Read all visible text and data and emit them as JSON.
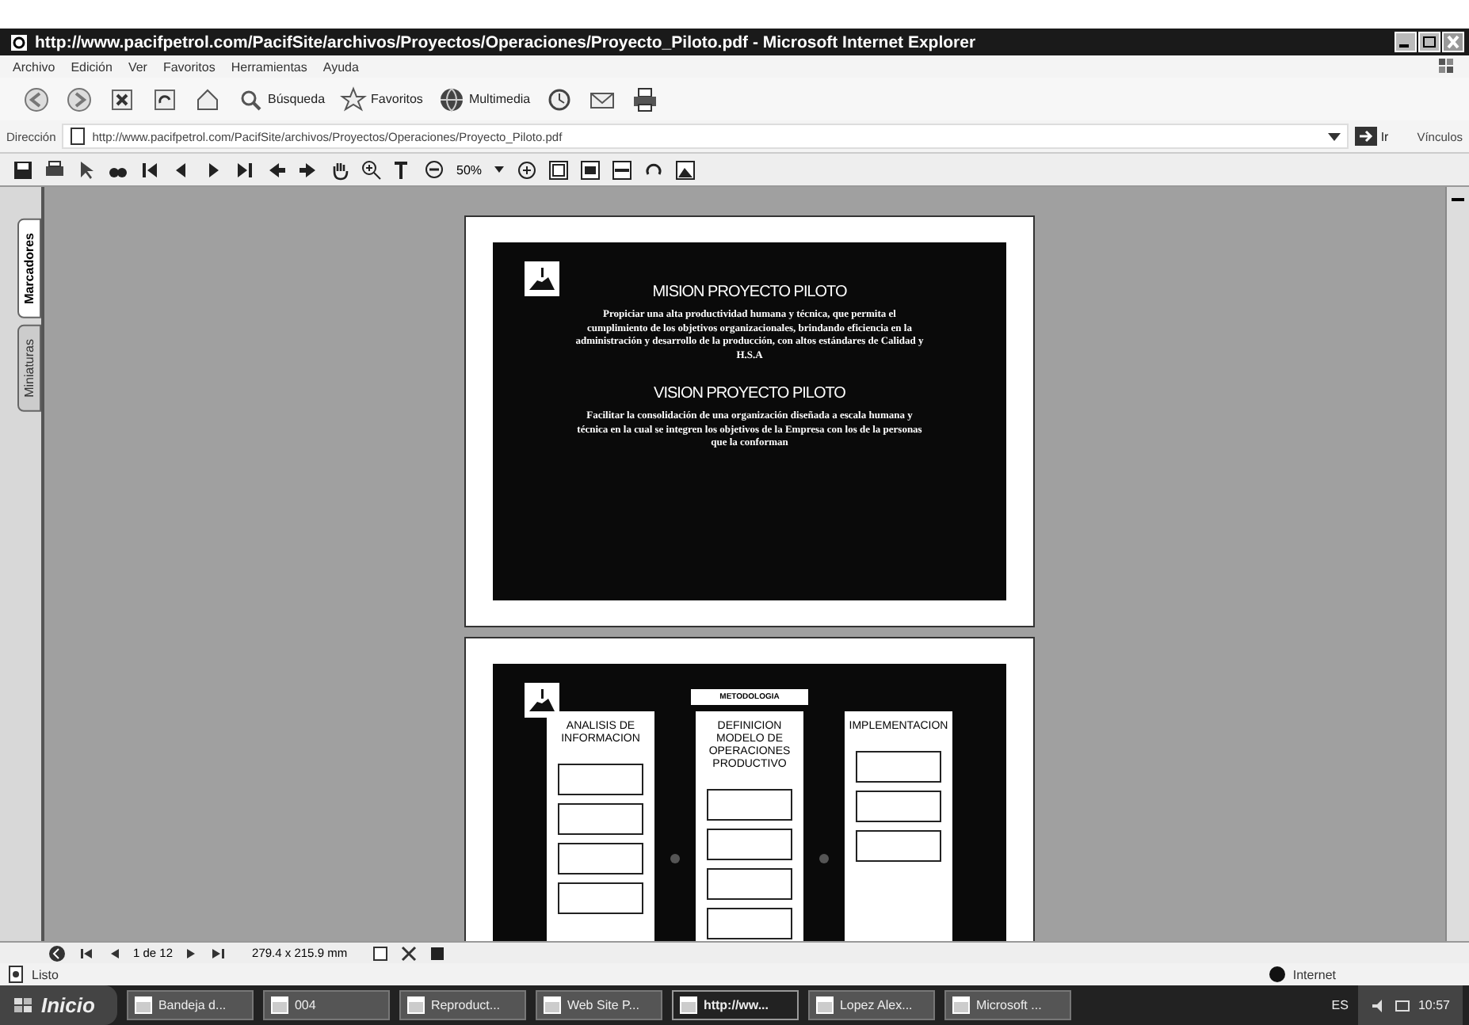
{
  "window": {
    "title": "http://www.pacifpetrol.com/PacifSite/archivos/Proyectos/Operaciones/Proyecto_Piloto.pdf - Microsoft Internet Explorer"
  },
  "menu": [
    "Archivo",
    "Edición",
    "Ver",
    "Favoritos",
    "Herramientas",
    "Ayuda"
  ],
  "toolbar": [
    {
      "kind": "back"
    },
    {
      "kind": "forward"
    },
    {
      "kind": "stop"
    },
    {
      "kind": "refresh"
    },
    {
      "kind": "home"
    },
    {
      "kind": "search",
      "label": "Búsqueda"
    },
    {
      "kind": "favorites",
      "label": "Favoritos"
    },
    {
      "kind": "media",
      "label": "Multimedia"
    },
    {
      "kind": "history"
    },
    {
      "kind": "mail"
    },
    {
      "kind": "print"
    }
  ],
  "address": {
    "label": "Dirección",
    "url": "http://www.pacifpetrol.com/PacifSite/archivos/Proyectos/Operaciones/Proyecto_Piloto.pdf",
    "go": "Ir",
    "links": "Vínculos"
  },
  "pdf_toolbar": {
    "zoom": "50%"
  },
  "side_tabs": [
    {
      "label": "Marcadores",
      "selected": true
    },
    {
      "label": "Miniaturas",
      "selected": false
    }
  ],
  "pages": [
    {
      "kind": "text",
      "blocks": [
        {
          "heading": "MISION PROYECTO PILOTO",
          "body": "Propiciar una alta productividad humana y técnica, que permita el cumplimiento de los objetivos organizacionales, brindando eficiencia en la administración y desarrollo de la producción, con altos estándares de Calidad y H.S.A"
        },
        {
          "heading": "VISION PROYECTO PILOTO",
          "body": "Facilitar la consolidación de una organización diseñada a escala humana y técnica en la cual se integren los objetivos de la Empresa con los de la personas que la conforman"
        }
      ]
    },
    {
      "kind": "diagram",
      "title": "METODOLOGIA",
      "columns": [
        "ANALISIS DE INFORMACION",
        "DEFINICION MODELO DE OPERACIONES PRODUCTIVO",
        "IMPLEMENTACION"
      ]
    }
  ],
  "nav": {
    "page": "1 de 12",
    "size": "279.4 x 215.9 mm"
  },
  "status": {
    "text": "Listo",
    "zone": "Internet"
  },
  "taskbar": {
    "start": "Inicio",
    "tasks": [
      {
        "label": "Bandeja d...",
        "selected": false
      },
      {
        "label": "004",
        "selected": false
      },
      {
        "label": "Reproduct...",
        "selected": false
      },
      {
        "label": "Web Site P...",
        "selected": false
      },
      {
        "label": "http://ww...",
        "selected": true
      },
      {
        "label": "Lopez Alex...",
        "selected": false
      },
      {
        "label": "Microsoft ...",
        "selected": false
      }
    ],
    "lang": "ES",
    "clock": "10:57"
  }
}
